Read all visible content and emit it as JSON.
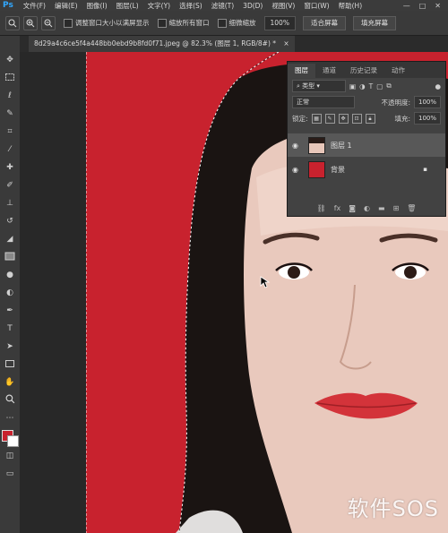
{
  "app": {
    "logo": "Ps"
  },
  "menu": [
    "文件(F)",
    "编辑(E)",
    "图像(I)",
    "图层(L)",
    "文字(Y)",
    "选择(S)",
    "滤镜(T)",
    "3D(D)",
    "视图(V)",
    "窗口(W)",
    "帮助(H)"
  ],
  "window_controls": {
    "minimize": "—",
    "maximize": "□",
    "close": "✕"
  },
  "options": {
    "tool_icon": "zoom-icon",
    "checkbox_resize": "调整窗口大小以满屏显示",
    "checkbox_zoom_all": "缩放所有窗口",
    "checkbox_scrubby": "细微缩放",
    "zoom_value": "100%",
    "fit_screen": "适合屏幕",
    "fill_screen": "填充屏幕"
  },
  "document": {
    "tab_title": "8d29a4c6ce5f4a448bb0ebd9b8fd0f71.jpeg @ 82.3% (图层 1, RGB/8#) *",
    "close": "×"
  },
  "colors": {
    "foreground": "#c8222e",
    "background": "#ffffff",
    "canvas_red": "#c8222e"
  },
  "layers_panel": {
    "tabs": [
      "图层",
      "通道",
      "历史记录",
      "动作"
    ],
    "filter_kind": "类型",
    "blend_mode": "正常",
    "opacity_label": "不透明度:",
    "opacity_value": "100%",
    "lock_label": "锁定:",
    "fill_label": "填充:",
    "fill_value": "100%",
    "layers": [
      {
        "name": "图层 1",
        "selected": true
      },
      {
        "name": "背景",
        "selected": false
      }
    ],
    "bottom_icons": [
      "link-icon",
      "fx-icon",
      "mask-icon",
      "adjustment-icon",
      "group-icon",
      "new-layer-icon",
      "delete-icon"
    ]
  },
  "watermark": "软件SOS"
}
